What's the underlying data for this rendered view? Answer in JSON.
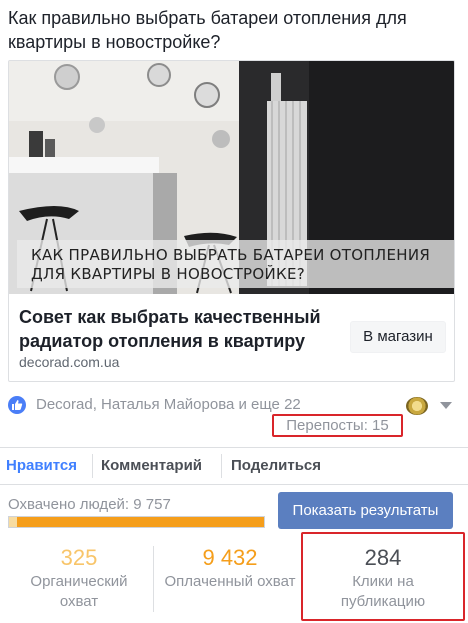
{
  "post": {
    "text": "Как правильно выбрать батареи отопления для квартиры в новостройке?"
  },
  "link_card": {
    "image_overlay_text": "КАК ПРАВИЛЬНО ВЫБРАТЬ БАТАРЕИ ОТОПЛЕНИЯ ДЛЯ КВАРТИРЫ В НОВОСТРОЙКЕ?",
    "title": "Совет как выбрать качественный радиатор отопления в квартиру",
    "domain": "decorad.com.ua",
    "cta_label": "В магазин"
  },
  "reactions": {
    "icon": "like-icon",
    "text": "Decorad, Наталья Майорова и еще 22",
    "reposts": "Перепосты: 15"
  },
  "actions": {
    "like": "Нравится",
    "comment": "Комментарий",
    "share": "Поделиться",
    "active_color": "#4080ff"
  },
  "reach": {
    "label": "Охвачено людей: 9 757",
    "organic_fraction": 0.033,
    "paid_fraction": 0.967,
    "organic_color": "#f8dca0",
    "paid_color": "#f59e1b",
    "boost_button": "Показать результаты",
    "boost_color": "#5b7fc0"
  },
  "metrics": {
    "organic": {
      "value": "325",
      "label_line1": "Органический",
      "label_line2": "охват",
      "color": "#f8c56a"
    },
    "paid": {
      "value": "9 432",
      "label_line1": "Оплаченный охват",
      "color": "#f59e1b"
    },
    "clicks": {
      "value": "284",
      "label_line1": "Клики на",
      "label_line2": "публикацию",
      "color": "#4b4f56"
    }
  }
}
